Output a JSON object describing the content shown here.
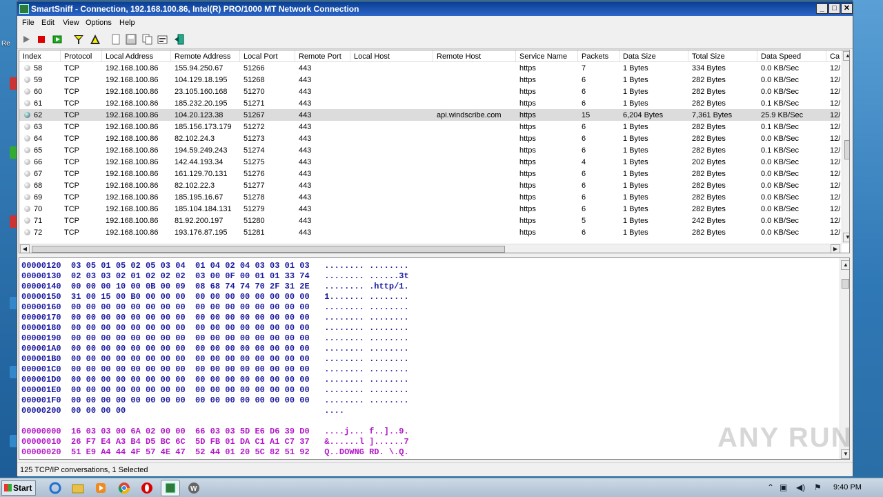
{
  "window": {
    "title": "SmartSniff  -  Connection, 192.168.100.86, Intel(R) PRO/1000 MT Network Connection",
    "min_label": "_",
    "max_label": "□",
    "close_label": "✕"
  },
  "menu": [
    "File",
    "Edit",
    "View",
    "Options",
    "Help"
  ],
  "toolbar": {
    "icons": [
      "play-icon",
      "stop-icon",
      "capture-icon",
      "filter-icon",
      "filter-alt-icon",
      "new-icon",
      "save-icon",
      "copy-icon",
      "properties-icon",
      "exit-icon"
    ]
  },
  "grid": {
    "columns": [
      "Index",
      "Protocol",
      "Local Address",
      "Remote Address",
      "Local Port",
      "Remote Port",
      "Local Host",
      "Remote Host",
      "Service Name",
      "Packets",
      "Data Size",
      "Total Size",
      "Data Speed",
      "Ca"
    ],
    "rows": [
      [
        "58",
        "TCP",
        "192.168.100.86",
        "155.94.250.67",
        "51266",
        "443",
        "",
        "",
        "https",
        "7",
        "1 Bytes",
        "334 Bytes",
        "0.0 KB/Sec",
        "12/"
      ],
      [
        "59",
        "TCP",
        "192.168.100.86",
        "104.129.18.195",
        "51268",
        "443",
        "",
        "",
        "https",
        "6",
        "1 Bytes",
        "282 Bytes",
        "0.0 KB/Sec",
        "12/"
      ],
      [
        "60",
        "TCP",
        "192.168.100.86",
        "23.105.160.168",
        "51270",
        "443",
        "",
        "",
        "https",
        "6",
        "1 Bytes",
        "282 Bytes",
        "0.0 KB/Sec",
        "12/"
      ],
      [
        "61",
        "TCP",
        "192.168.100.86",
        "185.232.20.195",
        "51271",
        "443",
        "",
        "",
        "https",
        "6",
        "1 Bytes",
        "282 Bytes",
        "0.1 KB/Sec",
        "12/"
      ],
      [
        "62",
        "TCP",
        "192.168.100.86",
        "104.20.123.38",
        "51267",
        "443",
        "",
        "api.windscribe.com",
        "https",
        "15",
        "6,204 Bytes",
        "7,361 Bytes",
        "25.9 KB/Sec",
        "12/"
      ],
      [
        "63",
        "TCP",
        "192.168.100.86",
        "185.156.173.179",
        "51272",
        "443",
        "",
        "",
        "https",
        "6",
        "1 Bytes",
        "282 Bytes",
        "0.1 KB/Sec",
        "12/"
      ],
      [
        "64",
        "TCP",
        "192.168.100.86",
        "82.102.24.3",
        "51273",
        "443",
        "",
        "",
        "https",
        "6",
        "1 Bytes",
        "282 Bytes",
        "0.0 KB/Sec",
        "12/"
      ],
      [
        "65",
        "TCP",
        "192.168.100.86",
        "194.59.249.243",
        "51274",
        "443",
        "",
        "",
        "https",
        "6",
        "1 Bytes",
        "282 Bytes",
        "0.1 KB/Sec",
        "12/"
      ],
      [
        "66",
        "TCP",
        "192.168.100.86",
        "142.44.193.34",
        "51275",
        "443",
        "",
        "",
        "https",
        "4",
        "1 Bytes",
        "202 Bytes",
        "0.0 KB/Sec",
        "12/"
      ],
      [
        "67",
        "TCP",
        "192.168.100.86",
        "161.129.70.131",
        "51276",
        "443",
        "",
        "",
        "https",
        "6",
        "1 Bytes",
        "282 Bytes",
        "0.0 KB/Sec",
        "12/"
      ],
      [
        "68",
        "TCP",
        "192.168.100.86",
        "82.102.22.3",
        "51277",
        "443",
        "",
        "",
        "https",
        "6",
        "1 Bytes",
        "282 Bytes",
        "0.0 KB/Sec",
        "12/"
      ],
      [
        "69",
        "TCP",
        "192.168.100.86",
        "185.195.16.67",
        "51278",
        "443",
        "",
        "",
        "https",
        "6",
        "1 Bytes",
        "282 Bytes",
        "0.0 KB/Sec",
        "12/"
      ],
      [
        "70",
        "TCP",
        "192.168.100.86",
        "185.104.184.131",
        "51279",
        "443",
        "",
        "",
        "https",
        "6",
        "1 Bytes",
        "282 Bytes",
        "0.0 KB/Sec",
        "12/"
      ],
      [
        "71",
        "TCP",
        "192.168.100.86",
        "81.92.200.197",
        "51280",
        "443",
        "",
        "",
        "https",
        "5",
        "1 Bytes",
        "242 Bytes",
        "0.0 KB/Sec",
        "12/"
      ],
      [
        "72",
        "TCP",
        "192.168.100.86",
        "193.176.87.195",
        "51281",
        "443",
        "",
        "",
        "https",
        "6",
        "1 Bytes",
        "282 Bytes",
        "0.0 KB/Sec",
        "12/"
      ]
    ],
    "selected_index": "62"
  },
  "hex_out": [
    "00000120  03 05 01 05 02 05 03 04  01 04 02 04 03 03 01 03   ........ ........",
    "00000130  02 03 03 02 01 02 02 02  03 00 0F 00 01 01 33 74   ........ ......3t",
    "00000140  00 00 00 10 00 0B 00 09  08 68 74 74 70 2F 31 2E   ........ .http/1.",
    "00000150  31 00 15 00 B0 00 00 00  00 00 00 00 00 00 00 00   1....... ........",
    "00000160  00 00 00 00 00 00 00 00  00 00 00 00 00 00 00 00   ........ ........",
    "00000170  00 00 00 00 00 00 00 00  00 00 00 00 00 00 00 00   ........ ........",
    "00000180  00 00 00 00 00 00 00 00  00 00 00 00 00 00 00 00   ........ ........",
    "00000190  00 00 00 00 00 00 00 00  00 00 00 00 00 00 00 00   ........ ........",
    "000001A0  00 00 00 00 00 00 00 00  00 00 00 00 00 00 00 00   ........ ........",
    "000001B0  00 00 00 00 00 00 00 00  00 00 00 00 00 00 00 00   ........ ........",
    "000001C0  00 00 00 00 00 00 00 00  00 00 00 00 00 00 00 00   ........ ........",
    "000001D0  00 00 00 00 00 00 00 00  00 00 00 00 00 00 00 00   ........ ........",
    "000001E0  00 00 00 00 00 00 00 00  00 00 00 00 00 00 00 00   ........ ........",
    "000001F0  00 00 00 00 00 00 00 00  00 00 00 00 00 00 00 00   ........ ........",
    "00000200  00 00 00 00                                        ...."
  ],
  "hex_in": [
    "00000000  16 03 03 00 6A 02 00 00  66 03 03 5D E6 D6 39 D0   ....j... f..]..9.",
    "00000010  26 F7 E4 A3 B4 D5 BC 6C  5D FB 01 DA C1 A1 C7 37   &......l ]......7",
    "00000020  51 E9 A4 44 4F 57 4E 47  52 44 01 20 5C 82 51 92   Q..DOWNG RD. \\.Q."
  ],
  "status": "125 TCP/IP conversations, 1 Selected",
  "taskbar": {
    "start_label": "Start",
    "clock": "9:40 PM",
    "apps": [
      "ie-icon",
      "explorer-icon",
      "media-player-icon",
      "chrome-icon",
      "opera-icon",
      "smartsniff-icon",
      "word-icon"
    ]
  },
  "desktop": {
    "label_re": "Re"
  },
  "watermark": "ANY RUN"
}
